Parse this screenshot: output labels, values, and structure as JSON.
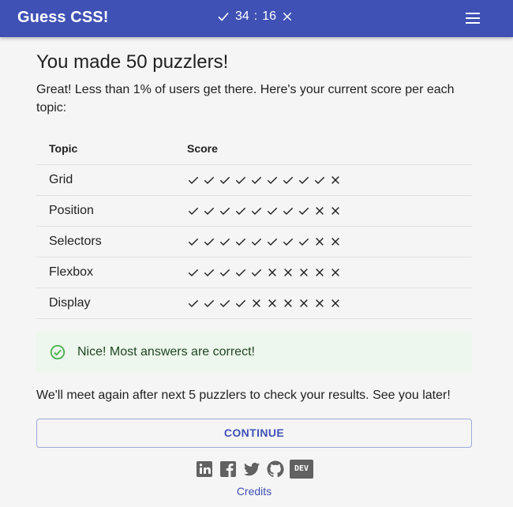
{
  "app": {
    "title": "Guess CSS!",
    "correct_count": "34",
    "separator": ":",
    "wrong_count": "16"
  },
  "main": {
    "heading": "You made 50 puzzlers!",
    "intro": "Great! Less than 1% of users get there. Here's your current score per each topic:",
    "table": {
      "headers": {
        "topic": "Topic",
        "score": "Score"
      },
      "rows": [
        {
          "topic": "Grid",
          "correct": 9,
          "wrong": 1
        },
        {
          "topic": "Position",
          "correct": 8,
          "wrong": 2
        },
        {
          "topic": "Selectors",
          "correct": 8,
          "wrong": 2
        },
        {
          "topic": "Flexbox",
          "correct": 5,
          "wrong": 5
        },
        {
          "topic": "Display",
          "correct": 4,
          "wrong": 6
        }
      ]
    },
    "alert": "Nice! Most answers are correct!",
    "meet_text": "We'll meet again after next 5 puzzlers to check your results. See you later!",
    "continue_label": "CONTINUE"
  },
  "footer": {
    "socials": [
      "linkedin-icon",
      "facebook-icon",
      "twitter-icon",
      "github-icon",
      "dev-icon"
    ],
    "dev_label": "DEV",
    "credits": "Credits"
  },
  "colors": {
    "primary": "#3f51b5",
    "background": "#f5f5f5",
    "success_bg": "#edf7ed",
    "success_icon": "#4caf50",
    "success_text": "#1e4620"
  }
}
